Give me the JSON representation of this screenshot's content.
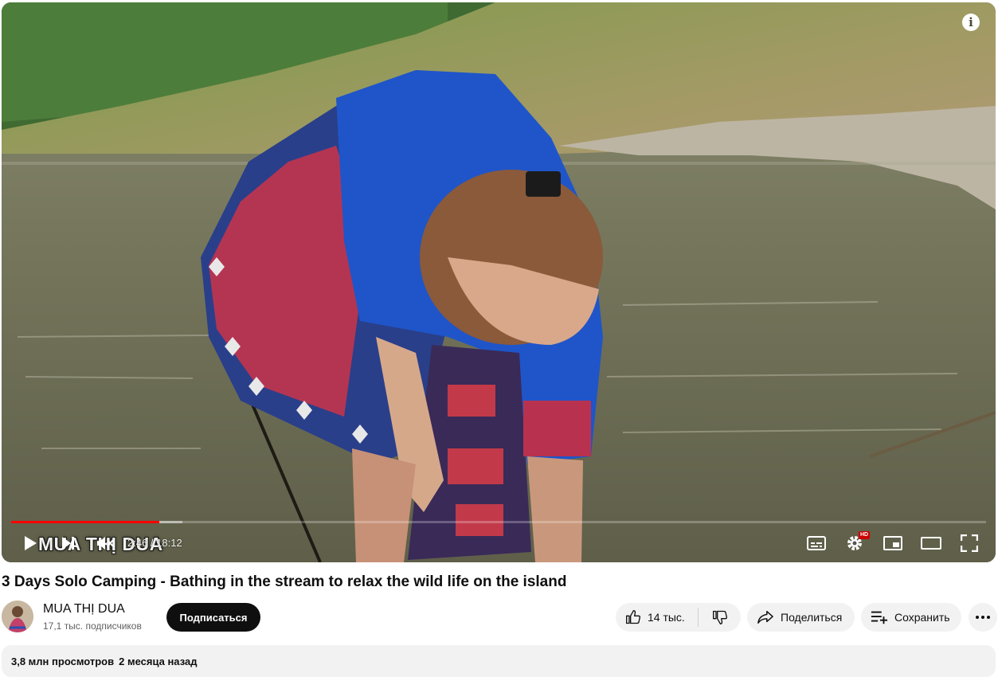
{
  "player": {
    "watermark": "MUA THỊ DUA",
    "current_time": "2:46",
    "duration": "18:12",
    "time_separator": " / ",
    "progress_played_fraction": 0.152,
    "progress_loaded_fraction": 0.176,
    "settings_badge": "HD",
    "icons": [
      "info-icon",
      "play-icon",
      "next-icon",
      "mute-icon",
      "subtitles-icon",
      "settings-icon",
      "miniplayer-icon",
      "theater-mode-icon",
      "fullscreen-icon"
    ]
  },
  "video": {
    "title": "3 Days Solo Camping - Bathing in the stream to relax the wild life on the island"
  },
  "channel": {
    "name": "MUA THỊ DUA",
    "subscribers": "17,1 тыс. подписчиков",
    "subscribe_label": "Подписаться"
  },
  "actions": {
    "like_count": "14 тыс.",
    "share_label": "Поделиться",
    "save_label": "Сохранить"
  },
  "description": {
    "views": "3,8 млн просмотров",
    "date": "2 месяца назад"
  },
  "colors": {
    "progress_red": "#ff0000",
    "subscribe_bg": "#0f0f0f",
    "pill_bg": "#f2f2f2"
  }
}
